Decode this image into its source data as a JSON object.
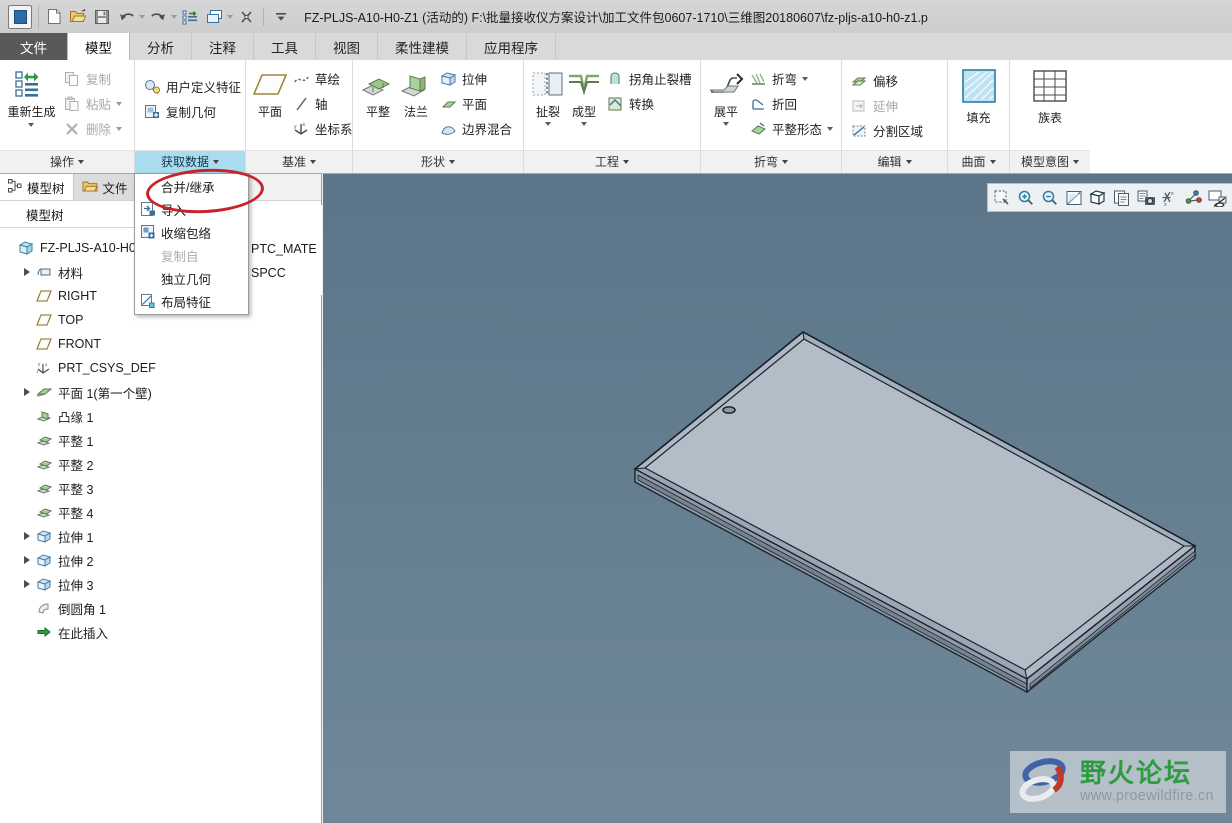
{
  "window": {
    "title": "FZ-PLJS-A10-H0-Z1 (活动的) F:\\批量接收仪方案设计\\加工文件包0607-1710\\三维图20180607\\fz-pljs-a10-h0-z1.p",
    "app_icon": "application-icon"
  },
  "quick_access": [
    {
      "name": "new-file-icon",
      "label": "新建"
    },
    {
      "name": "open-file-icon",
      "label": "打开"
    },
    {
      "name": "save-icon",
      "label": "保存"
    },
    {
      "name": "undo-icon",
      "label": "撤消"
    },
    {
      "name": "redo-icon",
      "label": "重做"
    },
    {
      "name": "regenerate-icon",
      "label": "重新生成"
    },
    {
      "name": "window-icon",
      "label": "窗口"
    },
    {
      "name": "close-window-icon",
      "label": "关闭"
    },
    {
      "name": "customize-qat-icon",
      "label": "自定义快速访问工具栏"
    }
  ],
  "tabs": [
    {
      "label": "文件",
      "kind": "file"
    },
    {
      "label": "模型",
      "kind": "active"
    },
    {
      "label": "分析",
      "kind": "normal"
    },
    {
      "label": "注释",
      "kind": "normal"
    },
    {
      "label": "工具",
      "kind": "normal"
    },
    {
      "label": "视图",
      "kind": "normal"
    },
    {
      "label": "柔性建模",
      "kind": "normal"
    },
    {
      "label": "应用程序",
      "kind": "normal"
    }
  ],
  "ribbon": {
    "groups": [
      {
        "label": "操作",
        "highlight": false,
        "big": [
          {
            "label": "重新生成",
            "icon": "regenerate-icon",
            "has_caret": true
          }
        ],
        "small": [
          {
            "label": "复制",
            "icon": "copy-icon",
            "disabled": true,
            "caret": false
          },
          {
            "label": "粘贴",
            "icon": "paste-icon",
            "disabled": true,
            "caret": true
          },
          {
            "label": "删除",
            "icon": "delete-icon",
            "disabled": true,
            "caret": true
          }
        ]
      },
      {
        "label": "获取数据",
        "highlight": true,
        "big": [],
        "small": [
          {
            "label": "用户定义特征",
            "icon": "udf-icon",
            "disabled": false,
            "caret": false
          },
          {
            "label": "复制几何",
            "icon": "copy-geometry-icon",
            "disabled": false,
            "caret": false
          }
        ]
      },
      {
        "label": "基准",
        "highlight": false,
        "big": [
          {
            "label": "平面",
            "icon": "datum-plane-icon",
            "has_caret": false
          }
        ],
        "small": [
          {
            "label": "草绘",
            "icon": "sketch-icon",
            "disabled": false,
            "caret": false
          },
          {
            "label": "轴",
            "icon": "datum-axis-icon",
            "disabled": false,
            "caret": false
          },
          {
            "label": "坐标系",
            "icon": "coordinate-system-icon",
            "disabled": false,
            "caret": false
          }
        ]
      },
      {
        "label": "形状",
        "highlight": false,
        "big": [
          {
            "label": "平整",
            "icon": "flat-wall-icon",
            "has_caret": false
          },
          {
            "label": "法兰",
            "icon": "flange-icon",
            "has_caret": false
          }
        ],
        "small": [
          {
            "label": "拉伸",
            "icon": "extrude-icon",
            "disabled": false,
            "caret": false
          },
          {
            "label": "平面",
            "icon": "fill-plane-icon",
            "disabled": false,
            "caret": false
          },
          {
            "label": "边界混合",
            "icon": "boundary-blend-icon",
            "disabled": false,
            "caret": false
          }
        ]
      },
      {
        "label": "工程",
        "highlight": false,
        "big": [
          {
            "label": "扯裂",
            "icon": "rip-icon",
            "has_caret": true
          },
          {
            "label": "成型",
            "icon": "form-icon",
            "has_caret": true
          }
        ],
        "small": [
          {
            "label": "拐角止裂槽",
            "icon": "corner-relief-icon",
            "disabled": false,
            "caret": false
          },
          {
            "label": "转换",
            "icon": "conversion-icon",
            "disabled": false,
            "caret": false
          }
        ]
      },
      {
        "label": "折弯",
        "highlight": false,
        "big": [
          {
            "label": "展平",
            "icon": "unbend-icon",
            "has_caret": true
          }
        ],
        "small": [
          {
            "label": "折弯",
            "icon": "bend-icon",
            "disabled": false,
            "caret": true
          },
          {
            "label": "折回",
            "icon": "bend-back-icon",
            "disabled": false,
            "caret": false
          },
          {
            "label": "平整形态",
            "icon": "flat-state-icon",
            "disabled": false,
            "caret": true
          }
        ]
      },
      {
        "label": "编辑",
        "highlight": false,
        "big": [],
        "small": [
          {
            "label": "偏移",
            "icon": "offset-icon",
            "disabled": false,
            "caret": false
          },
          {
            "label": "延伸",
            "icon": "extend-icon",
            "disabled": true,
            "caret": false
          },
          {
            "label": "分割区域",
            "icon": "split-area-icon",
            "disabled": false,
            "caret": false
          }
        ]
      },
      {
        "label": "曲面",
        "highlight": false,
        "big": [
          {
            "label": "填充",
            "icon": "fill-surface-icon",
            "has_caret": false
          }
        ],
        "small": []
      },
      {
        "label": "模型意图",
        "highlight": false,
        "big": [
          {
            "label": "族表",
            "icon": "family-table-icon",
            "has_caret": false
          }
        ],
        "small": []
      }
    ]
  },
  "left_dock": {
    "nav_tabs": [
      {
        "label": "模型树",
        "icon": "model-tree-icon",
        "state": "selected"
      },
      {
        "label": "文件",
        "icon": "folder-browser-icon",
        "state": "inactive"
      }
    ],
    "panel_title": "模型树",
    "tree": [
      {
        "label": "FZ-PLJS-A10-H0-",
        "icon": "part-icon",
        "expandable": false,
        "indent": 0
      },
      {
        "label": "材料",
        "icon": "material-icon",
        "expandable": true,
        "indent": 0
      },
      {
        "label": "RIGHT",
        "icon": "datum-plane-icon",
        "expandable": false,
        "indent": 1
      },
      {
        "label": "TOP",
        "icon": "datum-plane-icon",
        "expandable": false,
        "indent": 1
      },
      {
        "label": "FRONT",
        "icon": "datum-plane-icon",
        "expandable": false,
        "indent": 1
      },
      {
        "label": "PRT_CSYS_DEF",
        "icon": "coordinate-system-icon",
        "expandable": false,
        "indent": 1
      },
      {
        "label": "平面 1(第一个壁)",
        "icon": "first-wall-icon",
        "expandable": true,
        "indent": 0
      },
      {
        "label": "凸缘 1",
        "icon": "flange-feature-icon",
        "expandable": false,
        "indent": 1
      },
      {
        "label": "平整 1",
        "icon": "flat-feature-icon",
        "expandable": false,
        "indent": 1
      },
      {
        "label": "平整 2",
        "icon": "flat-feature-icon",
        "expandable": false,
        "indent": 1
      },
      {
        "label": "平整 3",
        "icon": "flat-feature-icon",
        "expandable": false,
        "indent": 1
      },
      {
        "label": "平整 4",
        "icon": "flat-feature-icon",
        "expandable": false,
        "indent": 1
      },
      {
        "label": "拉伸 1",
        "icon": "extrude-feature-icon",
        "expandable": true,
        "indent": 0
      },
      {
        "label": "拉伸 2",
        "icon": "extrude-feature-icon",
        "expandable": true,
        "indent": 0
      },
      {
        "label": "拉伸 3",
        "icon": "extrude-feature-icon",
        "expandable": true,
        "indent": 0
      },
      {
        "label": "倒圆角 1",
        "icon": "round-feature-icon",
        "expandable": false,
        "indent": 1
      },
      {
        "label": "在此插入",
        "icon": "insert-here-icon",
        "expandable": false,
        "indent": 1
      }
    ]
  },
  "material_pane": {
    "header_icons": [
      "list-view-icon",
      "chevron-down-icon",
      "hide-items-icon"
    ],
    "rows": [
      "PTC_MATE",
      "SPCC"
    ]
  },
  "open_menu": {
    "items": [
      {
        "label": "合并/继承",
        "icon": "merge-inherit-icon",
        "disabled": false,
        "highlighted": true
      },
      {
        "label": "导入",
        "icon": "import-icon",
        "disabled": false,
        "highlighted": false
      },
      {
        "label": "收缩包络",
        "icon": "shrinkwrap-icon",
        "disabled": false,
        "highlighted": false
      },
      {
        "label": "复制自",
        "icon": "copy-from-icon",
        "disabled": true,
        "highlighted": false
      },
      {
        "label": "独立几何",
        "icon": "independent-geometry-icon",
        "disabled": false,
        "highlighted": false
      },
      {
        "label": "布局特征",
        "icon": "layout-feature-icon",
        "disabled": false,
        "highlighted": false
      }
    ],
    "annotation": {
      "shape": "red-ellipse",
      "color": "#c8232c",
      "targets": "合并/继承"
    }
  },
  "graphics_toolbar": [
    {
      "name": "zoom-region-icon",
      "label": "放大区域"
    },
    {
      "name": "zoom-in-icon",
      "label": "放大"
    },
    {
      "name": "zoom-out-icon",
      "label": "缩小"
    },
    {
      "name": "refit-icon",
      "label": "重新调整"
    },
    {
      "name": "view-orientation-icon",
      "label": "已保存方向"
    },
    {
      "name": "saved-views-icon",
      "label": "视图管理器"
    },
    {
      "name": "view-capture-icon",
      "label": "图像捕捉"
    },
    {
      "name": "datum-display-icon",
      "label": "基准显示过滤器"
    },
    {
      "name": "annotation-display-icon",
      "label": "注释显示"
    },
    {
      "name": "layer-display-icon",
      "label": "层显示"
    }
  ],
  "viewport": {
    "background_top": "#5c7589",
    "background_bottom": "#6f8799",
    "model_fill": "#aab5c1",
    "model_edge": "#1d2630",
    "model_name": "sheet-metal-panel"
  },
  "watermark": {
    "title": "野火论坛",
    "url": "www.proewildfire.cn",
    "logo_colors": [
      "#3f62a8",
      "#c0392b",
      "#2e9b3f"
    ]
  }
}
